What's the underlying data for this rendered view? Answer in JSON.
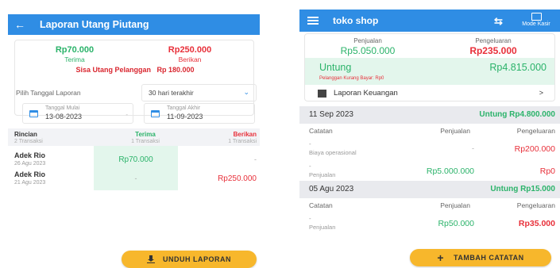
{
  "left": {
    "header": {
      "back_icon": "arrow-left-icon",
      "title": "Laporan Utang Piutang",
      "color": "#2f8de4"
    },
    "summary": {
      "terima_amount": "Rp70.000",
      "terima_label": "Terima",
      "berikan_amount": "Rp250.000",
      "berikan_label": "Berikan",
      "sisa_label": "Sisa Utang Pelanggan",
      "sisa_value": "Rp 180.000"
    },
    "filter": {
      "label": "Pilih Tanggal Laporan",
      "range": "30 hari terakhir"
    },
    "dates": {
      "start_label": "Tanggal Mulai",
      "start_value": "13-08-2023",
      "separator": "-",
      "end_label": "Tanggal Akhir",
      "end_value": "11-09-2023"
    },
    "table": {
      "headers": [
        {
          "title": "Rincian",
          "sub": "2 Transaksi"
        },
        {
          "title": "Terima",
          "sub": "1 Transaksi"
        },
        {
          "title": "Berikan",
          "sub": "1 Transaksi"
        }
      ],
      "rows": [
        {
          "name": "Adek Rio",
          "date": "26 Agu 2023",
          "terima": "Rp70.000",
          "berikan": "-"
        },
        {
          "name": "Adek Rio",
          "date": "21 Agu 2023",
          "terima": "-",
          "berikan": "Rp250.000"
        }
      ]
    },
    "download_button": "UNDUH LAPORAN"
  },
  "right": {
    "header": {
      "menu_icon": "hamburger-menu-icon",
      "title": "toko shop",
      "sync_icon": "sync-icon",
      "kasir_label": "Mode Kasir"
    },
    "summary": {
      "penjualan_label": "Penjualan",
      "penjualan_value": "Rp5.050.000",
      "pengeluaran_label": "Pengeluaran",
      "pengeluaran_value": "Rp235.000",
      "untung_label": "Untung",
      "untung_value": "Rp4.815.000",
      "warning": "Pelanggan Kurang Bayar: Rp0"
    },
    "laporan_link": "Laporan Keuangan",
    "laporan_arrow": ">",
    "columns": {
      "catatan": "Catatan",
      "penjualan": "Penjualan",
      "pengeluaran": "Pengeluaran"
    },
    "days": [
      {
        "date": "11 Sep 2023",
        "untung": "Untung Rp4.800.000",
        "items": [
          {
            "dash": "-",
            "name": "Biaya operasional",
            "penjualan": "-",
            "pengeluaran": "Rp200.000"
          },
          {
            "dash": "-",
            "name": "Penjualan",
            "penjualan": "Rp5.000.000",
            "pengeluaran": "Rp0"
          }
        ]
      },
      {
        "date": "05 Agu 2023",
        "untung": "Untung Rp15.000",
        "items": [
          {
            "dash": "-",
            "name": "Penjualan",
            "penjualan": "Rp50.000",
            "pengeluaran": "Rp35.000"
          }
        ]
      }
    ],
    "add_button": "TAMBAH CATATAN"
  }
}
